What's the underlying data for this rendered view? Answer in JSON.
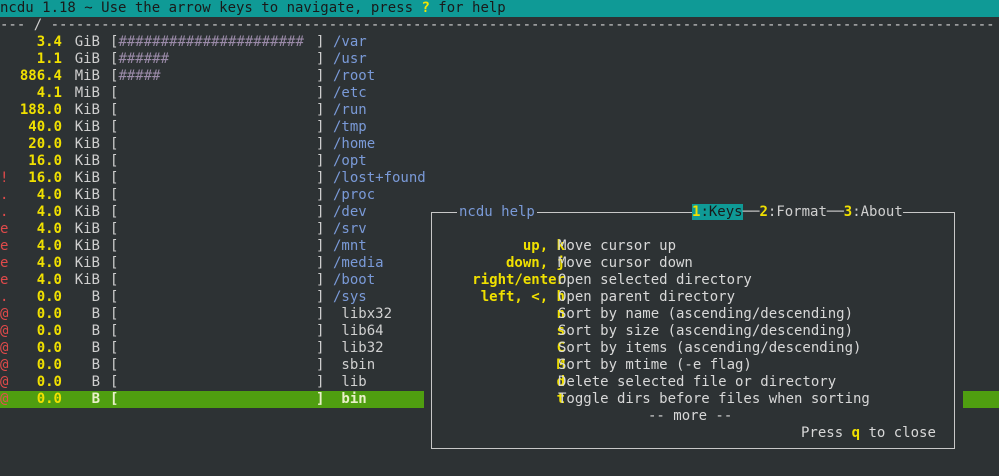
{
  "topbar": {
    "pre": "ncdu 1.18 ~ Use the arrow keys to navigate, press ",
    "key": "?",
    "post": " for help"
  },
  "pathbar": {
    "lead": "--- ",
    "path": "/",
    "dashes": " ----------------------------------------------------------------------------------------------------------------"
  },
  "entries": [
    {
      "flag": "",
      "size": "3.4",
      "unit": "GiB",
      "hashes": "######################",
      "name": "/var",
      "dir": true
    },
    {
      "flag": "",
      "size": "1.1",
      "unit": "GiB",
      "hashes": "######",
      "name": "/usr",
      "dir": true
    },
    {
      "flag": "",
      "size": "886.4",
      "unit": "MiB",
      "hashes": "#####",
      "name": "/root",
      "dir": true
    },
    {
      "flag": "",
      "size": "4.1",
      "unit": "MiB",
      "hashes": "",
      "name": "/etc",
      "dir": true
    },
    {
      "flag": "",
      "size": "188.0",
      "unit": "KiB",
      "hashes": "",
      "name": "/run",
      "dir": true
    },
    {
      "flag": "",
      "size": "40.0",
      "unit": "KiB",
      "hashes": "",
      "name": "/tmp",
      "dir": true
    },
    {
      "flag": "",
      "size": "20.0",
      "unit": "KiB",
      "hashes": "",
      "name": "/home",
      "dir": true
    },
    {
      "flag": "",
      "size": "16.0",
      "unit": "KiB",
      "hashes": "",
      "name": "/opt",
      "dir": true
    },
    {
      "flag": "!",
      "size": "16.0",
      "unit": "KiB",
      "hashes": "",
      "name": "/lost+found",
      "dir": true
    },
    {
      "flag": ".",
      "size": "4.0",
      "unit": "KiB",
      "hashes": "",
      "name": "/proc",
      "dir": true
    },
    {
      "flag": ".",
      "size": "4.0",
      "unit": "KiB",
      "hashes": "",
      "name": "/dev",
      "dir": true
    },
    {
      "flag": "e",
      "size": "4.0",
      "unit": "KiB",
      "hashes": "",
      "name": "/srv",
      "dir": true
    },
    {
      "flag": "e",
      "size": "4.0",
      "unit": "KiB",
      "hashes": "",
      "name": "/mnt",
      "dir": true
    },
    {
      "flag": "e",
      "size": "4.0",
      "unit": "KiB",
      "hashes": "",
      "name": "/media",
      "dir": true
    },
    {
      "flag": "e",
      "size": "4.0",
      "unit": "KiB",
      "hashes": "",
      "name": "/boot",
      "dir": true
    },
    {
      "flag": ".",
      "size": "0.0",
      "unit": "B",
      "hashes": "",
      "name": "/sys",
      "dir": true
    },
    {
      "flag": "@",
      "size": "0.0",
      "unit": "B",
      "hashes": "",
      "name": " libx32",
      "dir": false
    },
    {
      "flag": "@",
      "size": "0.0",
      "unit": "B",
      "hashes": "",
      "name": " lib64",
      "dir": false
    },
    {
      "flag": "@",
      "size": "0.0",
      "unit": "B",
      "hashes": "",
      "name": " lib32",
      "dir": false
    },
    {
      "flag": "@",
      "size": "0.0",
      "unit": "B",
      "hashes": "",
      "name": " sbin",
      "dir": false
    },
    {
      "flag": "@",
      "size": "0.0",
      "unit": "B",
      "hashes": "",
      "name": " lib",
      "dir": false
    },
    {
      "flag": "@",
      "size": "0.0",
      "unit": "B",
      "hashes": "",
      "name": " bin",
      "dir": false,
      "selected": true
    }
  ],
  "help": {
    "title": "ncdu help",
    "tabs": [
      {
        "num": "1",
        "label": ":Keys",
        "active": true
      },
      {
        "num": "2",
        "label": ":Format",
        "active": false
      },
      {
        "num": "3",
        "label": ":About",
        "active": false
      }
    ],
    "rows": [
      {
        "key": "up, k",
        "desc": "Move cursor up"
      },
      {
        "key": "down, j",
        "desc": "Move cursor down"
      },
      {
        "key": "right/enter",
        "desc": "Open selected directory"
      },
      {
        "key": "left, <, h",
        "desc": "Open parent directory"
      },
      {
        "key": "n",
        "desc": "Sort by name (ascending/descending)"
      },
      {
        "key": "s",
        "desc": "Sort by size (ascending/descending)"
      },
      {
        "key": "C",
        "desc": "Sort by items (ascending/descending)"
      },
      {
        "key": "M",
        "desc": "Sort by mtime (-e flag)"
      },
      {
        "key": "d",
        "desc": "Delete selected file or directory"
      },
      {
        "key": "t",
        "desc": "Toggle dirs before files when sorting"
      }
    ],
    "more": "-- more --",
    "close_pre": "Press ",
    "close_key": "q",
    "close_post": " to close"
  },
  "colors": {
    "background": "#2d3234",
    "topbar": "#0f9a96",
    "selected_row": "#4f9e10",
    "size_text": "#f0e000",
    "dir_name": "#7a9ad8",
    "flag": "#e04a4a"
  }
}
